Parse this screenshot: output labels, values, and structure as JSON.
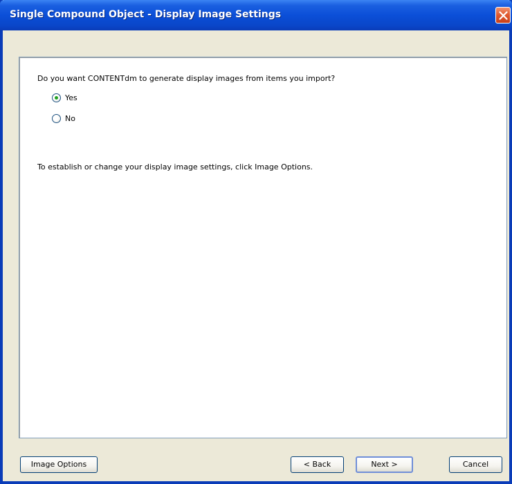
{
  "window": {
    "title": "Single Compound Object - Display Image Settings"
  },
  "content": {
    "question": "Do you want CONTENTdm to generate display images from items you import?",
    "options": [
      {
        "label": "Yes",
        "selected": true
      },
      {
        "label": "No",
        "selected": false
      }
    ],
    "instruction": "To establish or change your display image settings, click Image Options."
  },
  "buttons": {
    "image_options": "Image Options",
    "back": "< Back",
    "next": "Next >",
    "cancel": "Cancel"
  },
  "colors": {
    "titlebar": "#0a46c8",
    "dialog_background": "#ece9d8",
    "close_button": "#e0582e",
    "radio_selected": "#21a121"
  },
  "icons": {
    "close": "close-icon"
  }
}
